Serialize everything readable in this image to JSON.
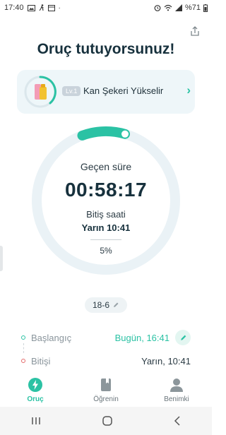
{
  "status_bar": {
    "time": "17:40",
    "battery": "%71"
  },
  "header": {
    "title": "Oruç tutuyorsunuz!"
  },
  "stage_card": {
    "level": "Lv.1",
    "label": "Kan Şekeri Yükselir",
    "chevron": "›",
    "accent": "#2bc2a4"
  },
  "timer": {
    "elapsed_label": "Geçen süre",
    "elapsed": "00:58:17",
    "end_label": "Bitiş saati",
    "end_value": "Yarın 10:41",
    "percent_label": "5%",
    "progress": 0.05
  },
  "plan": {
    "label": "18-6"
  },
  "schedule": {
    "start_label": "Başlangıç",
    "start_value": "Bugün, 16:41",
    "end_label": "Bitişi",
    "end_value": "Yarın, 10:41"
  },
  "nav": {
    "items": [
      {
        "label": "Oruç",
        "icon": "lightning-icon"
      },
      {
        "label": "Öğrenin",
        "icon": "book-icon"
      },
      {
        "label": "Benimki",
        "icon": "person-icon"
      }
    ],
    "active_color": "#2bc2a4"
  }
}
